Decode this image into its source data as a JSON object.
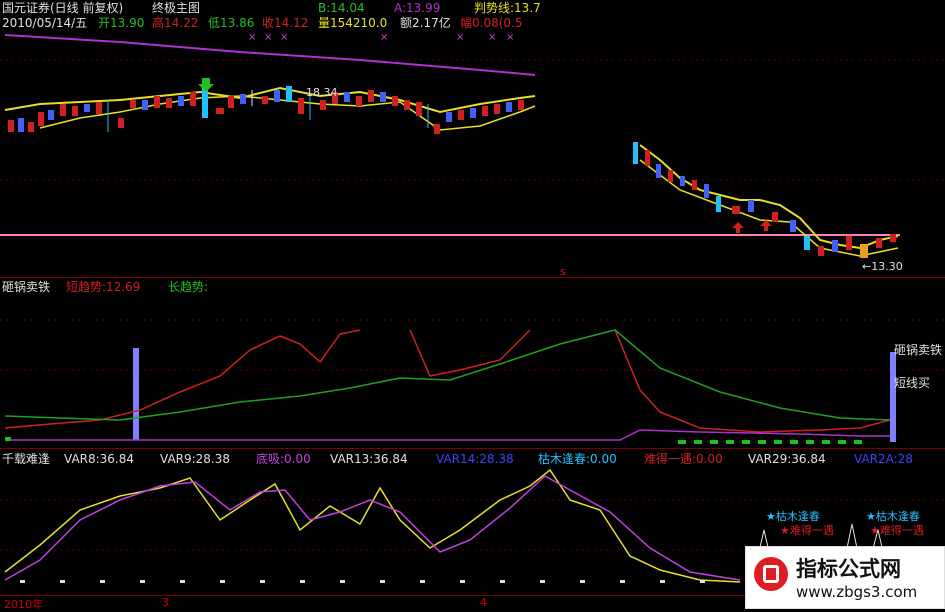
{
  "colors": {
    "bg": "#000000",
    "grid": "#7a0000",
    "yellow": "#e8e020",
    "magenta": "#b030d0",
    "red": "#d02020",
    "green": "#20a020",
    "white": "#e0e0e0",
    "cyan": "#20c0ff",
    "blue": "#4040ff",
    "bar": "#8080ff"
  },
  "header": {
    "stock": "国元证券(日线 前复权)",
    "indicator": "终极主图",
    "b_label": "B:14.04",
    "a_label": "A:13.99",
    "trend_label": "判势线:13.7",
    "date": "2010/05/14/五",
    "open": "开13.90",
    "high": "高14.22",
    "low": "低13.86",
    "close": "收14.12",
    "volume": "量154210.0",
    "amount": "额2.17亿",
    "change": "幅0.08(0.5"
  },
  "main_chart": {
    "high_annotation": "18.34",
    "low_annotation": "←13.30",
    "marker": "s"
  },
  "panel2": {
    "title": "砸锅卖铁",
    "short_label": "短趋势:12.69",
    "long_label": "长趋势:",
    "right_label_1": "砸锅卖铁",
    "right_label_2": "短线买"
  },
  "panel3": {
    "title": "千载难逢",
    "var8": "VAR8:36.84",
    "var9": "VAR9:28.38",
    "dibi": "底吸:0.00",
    "var13": "VAR13:36.84",
    "var14": "VAR14:28.38",
    "kumu": "枯木逢春:0.00",
    "nande": "难得一遇:0.00",
    "var29": "VAR29:36.84",
    "var2a": "VAR2A:28",
    "right_1": "★枯木逢春",
    "right_2": "★枯木逢春",
    "right_3": "★难得一遇",
    "right_4": "★难得一遇"
  },
  "axis": {
    "year": "2010年",
    "m3": "3",
    "m4": "4"
  },
  "watermark": {
    "name": "指标公式网",
    "url": "www.zbgs3.com"
  }
}
